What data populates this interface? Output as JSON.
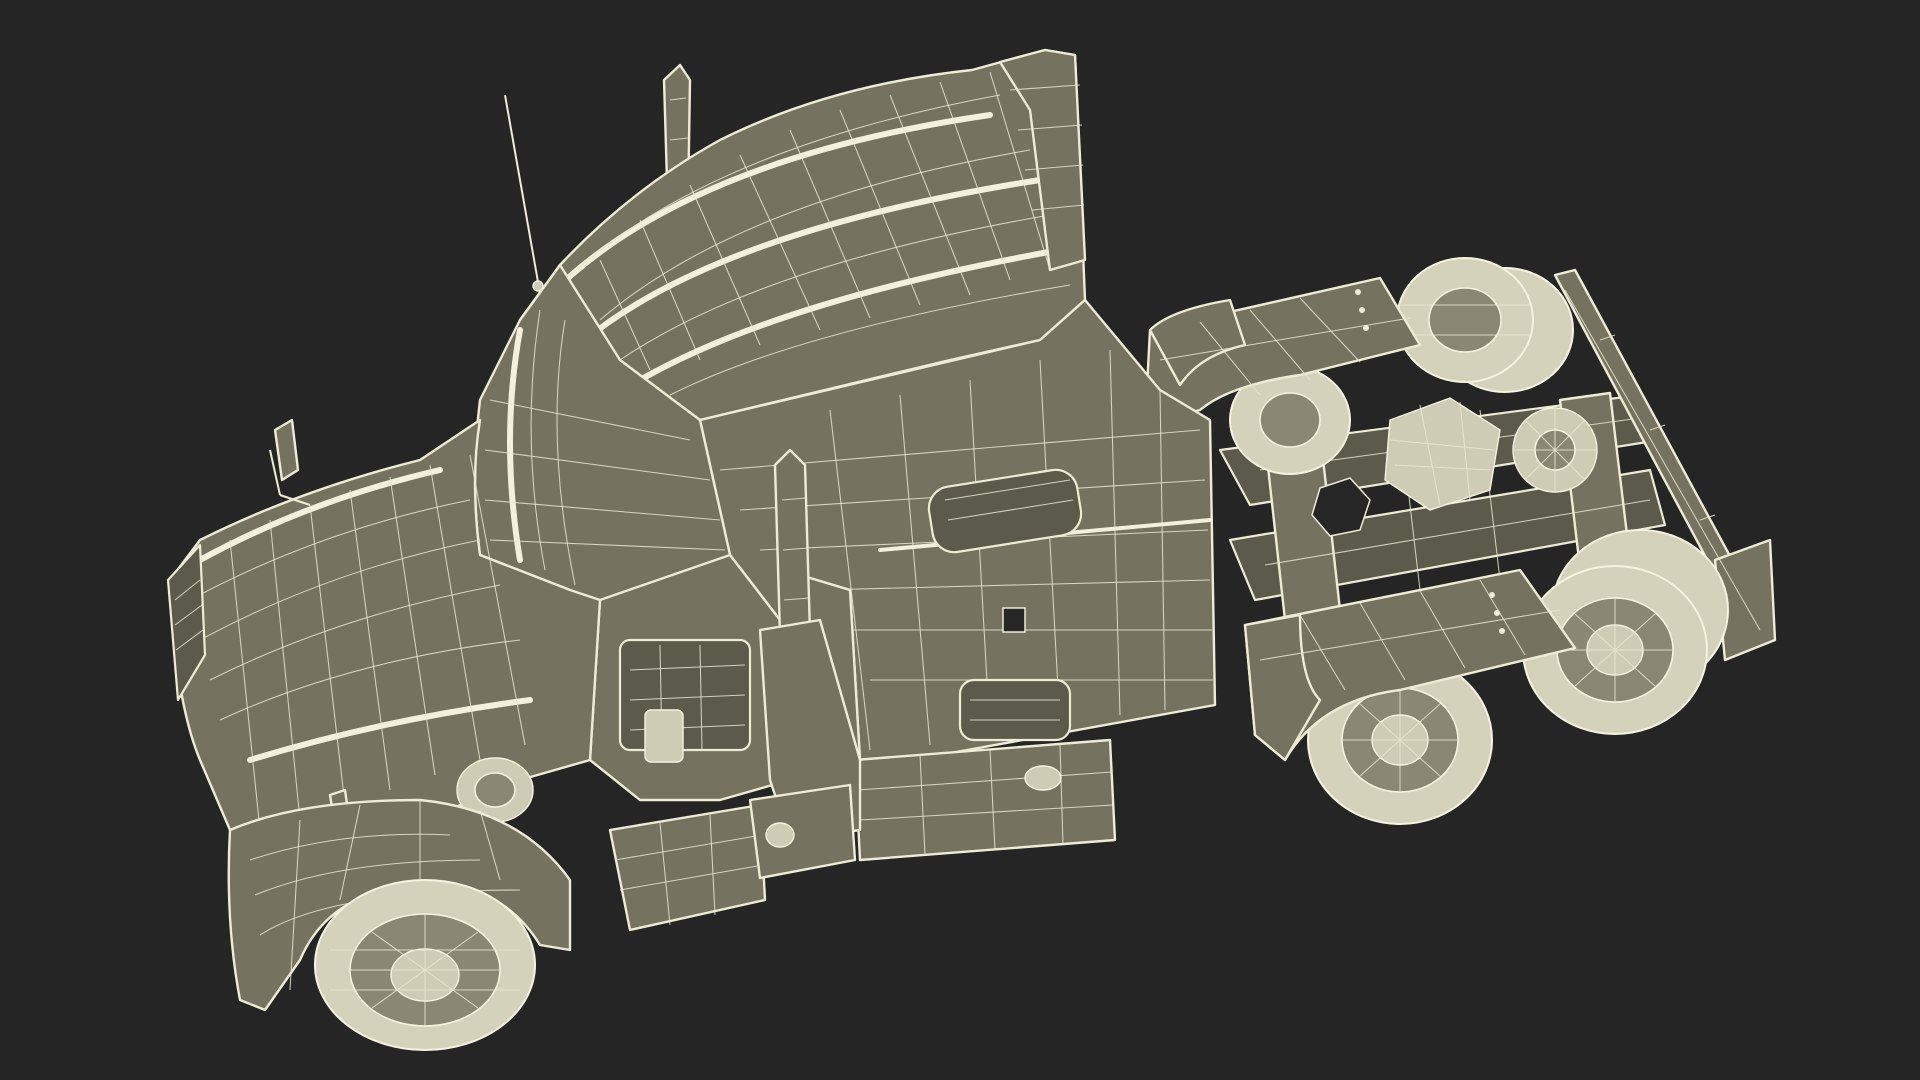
{
  "scene": {
    "background": "#252525",
    "model_fill": "#75725f",
    "wire_color": "#efecd6",
    "tire_fill": "#d5d2bc",
    "subject": "semi-truck-tractor-wireframe",
    "visible_text": []
  }
}
